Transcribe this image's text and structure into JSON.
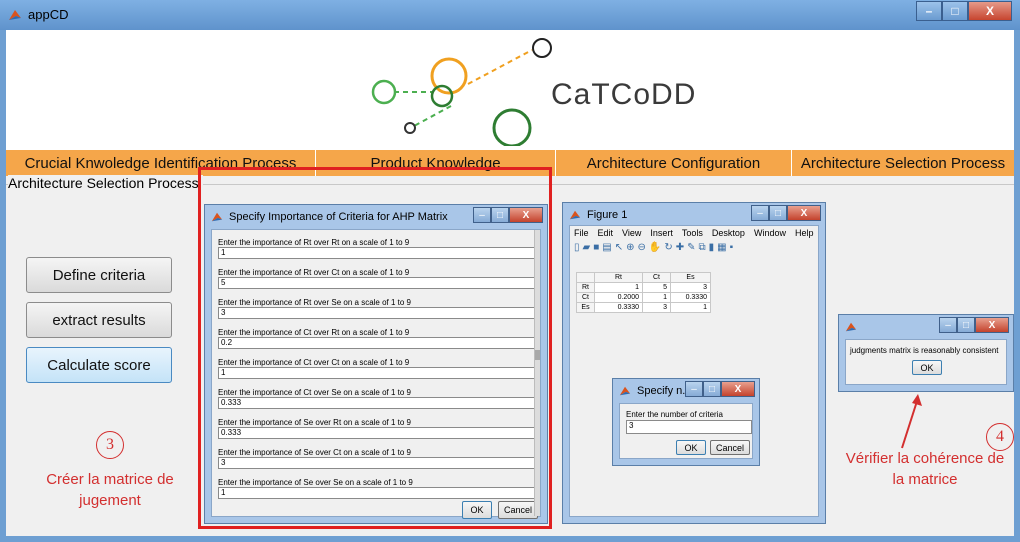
{
  "window": {
    "title": "appCD",
    "min_glyph": "–",
    "max_glyph": "□",
    "close_glyph": "X"
  },
  "banner": {
    "brand": "CaTCoDD"
  },
  "tabs": [
    {
      "label": "Crucial Knwoledge Identification Process"
    },
    {
      "label": "Product Knowledge"
    },
    {
      "label": "Architecture Configuration"
    },
    {
      "label": "Architecture Selection Process"
    }
  ],
  "panel": {
    "title": "Architecture Selection Process",
    "buttons": [
      {
        "label": "Define criteria"
      },
      {
        "label": "extract results"
      },
      {
        "label": "Calculate score"
      }
    ]
  },
  "ahp_dialog": {
    "title": "Specify Importance of Criteria for AHP Matrix",
    "fields": [
      {
        "label": "Enter the importance of Rt over Rt on a scale of 1 to 9",
        "value": "1"
      },
      {
        "label": "Enter the importance of Rt over Ct on a scale of 1 to 9",
        "value": "5"
      },
      {
        "label": "Enter the importance of Rt over Se on a scale of 1 to 9",
        "value": "3"
      },
      {
        "label": "Enter the importance of Ct over Rt on a scale of 1 to 9",
        "value": "0.2"
      },
      {
        "label": "Enter the importance of Ct over Ct on a scale of 1 to 9",
        "value": "1"
      },
      {
        "label": "Enter the importance of Ct over Se on a scale of 1 to 9",
        "value": "0.333"
      },
      {
        "label": "Enter the importance of Se over Rt on a scale of 1 to 9",
        "value": "0.333"
      },
      {
        "label": "Enter the importance of Se over Ct on a scale of 1 to 9",
        "value": "3"
      },
      {
        "label": "Enter the importance of Se over Se on a scale of 1 to 9",
        "value": "1"
      }
    ],
    "ok": "OK",
    "cancel": "Cancel"
  },
  "figure": {
    "title": "Figure 1",
    "menu": [
      "File",
      "Edit",
      "View",
      "Insert",
      "Tools",
      "Desktop",
      "Window",
      "Help"
    ],
    "table": {
      "columns": [
        "Rt",
        "Ct",
        "Es"
      ],
      "rows": [
        {
          "name": "Rt",
          "cells": [
            "1",
            "5",
            "3"
          ]
        },
        {
          "name": "Ct",
          "cells": [
            "0.2000",
            "1",
            "0.3330"
          ]
        },
        {
          "name": "Es",
          "cells": [
            "0.3330",
            "3",
            "1"
          ]
        }
      ]
    }
  },
  "criteria_dialog": {
    "title": "Specify n...",
    "label": "Enter the number of criteria",
    "value": "3",
    "ok": "OK",
    "cancel": "Cancel"
  },
  "consistency_dialog": {
    "message": "judgments matrix is reasonably consistent",
    "ok": "OK"
  },
  "annotations": {
    "step3_number": "3",
    "step3_text_1": "Créer la matrice de",
    "step3_text_2": "jugement",
    "step4_number": "4",
    "step4_text_1": "Vérifier la cohérence de",
    "step4_text_2": "la matrice"
  },
  "colors": {
    "tab_bar": "#f5a64a",
    "annotation": "#d32f2f",
    "window_frame": "#6e9fd2"
  }
}
